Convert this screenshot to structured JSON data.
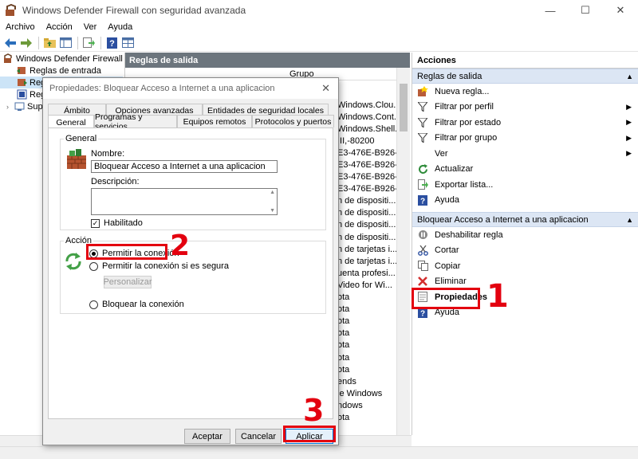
{
  "window": {
    "title": "Windows Defender Firewall con seguridad avanzada",
    "minimize": "—",
    "maximize": "☐",
    "close": "✕"
  },
  "menu": [
    "Archivo",
    "Acción",
    "Ver",
    "Ayuda"
  ],
  "tree": {
    "root": "Windows Defender Firewall con",
    "items": [
      "Reglas de entrada",
      "Regl",
      "Regl",
      "Supe"
    ]
  },
  "center": {
    "header": "Reglas de salida",
    "column_grupo": "Grupo",
    "groups": [
      "Windows.Clou...",
      "Windows.Cont...",
      "Windows.Shell...",
      "III,-80200",
      "E3-476E-B926-...",
      "E3-476E-B926-...",
      "E3-476E-B926-...",
      "E3-476E-B926-...",
      "n de dispositi...",
      "n de dispositi...",
      "n de dispositi...",
      "n de dispositi...",
      "n de tarjetas i...",
      "n de tarjetas i...",
      "uenta profesi...",
      "Video for Wi...",
      "ota",
      "ota",
      "ota",
      "ota",
      "ota",
      "ota",
      "ota",
      "ends",
      "le Windows",
      "ndows",
      "ota"
    ]
  },
  "actions": {
    "header": "Acciones",
    "section1": {
      "title": "Reglas de salida",
      "items": [
        "Nueva regla...",
        "Filtrar por perfil",
        "Filtrar por estado",
        "Filtrar por grupo",
        "Ver",
        "Actualizar",
        "Exportar lista...",
        "Ayuda"
      ]
    },
    "section2": {
      "title": "Bloquear Acceso a Internet a una aplicacion",
      "items": [
        "Deshabilitar regla",
        "Cortar",
        "Copiar",
        "Eliminar",
        "Propiedades",
        "Ayuda"
      ]
    }
  },
  "dialog": {
    "title": "Propiedades: Bloquear Acceso a Internet a una aplicacion",
    "tabs_back": [
      "Ámbito",
      "Opciones avanzadas",
      "Entidades de seguridad locales"
    ],
    "tabs_front": [
      "General",
      "Programas y servicios",
      "Equipos remotos",
      "Protocolos y puertos"
    ],
    "general_group": "General",
    "name_label": "Nombre:",
    "name_value": "Bloquear Acceso a Internet a una aplicacion",
    "description_label": "Descripción:",
    "enabled_label": "Habilitado",
    "action_group": "Acción",
    "radio_allow": "Permitir la conexión",
    "radio_allow_secure": "Permitir la conexión si es segura",
    "customize": "Personalizar",
    "radio_block": "Bloquear la conexión",
    "ok": "Aceptar",
    "cancel": "Cancelar",
    "apply": "Aplicar"
  },
  "annotations": [
    "1",
    "2",
    "3"
  ],
  "colors": {
    "highlight": "#e3000f",
    "center_header": "#6c757d",
    "actions_section": "#dce6f4"
  }
}
